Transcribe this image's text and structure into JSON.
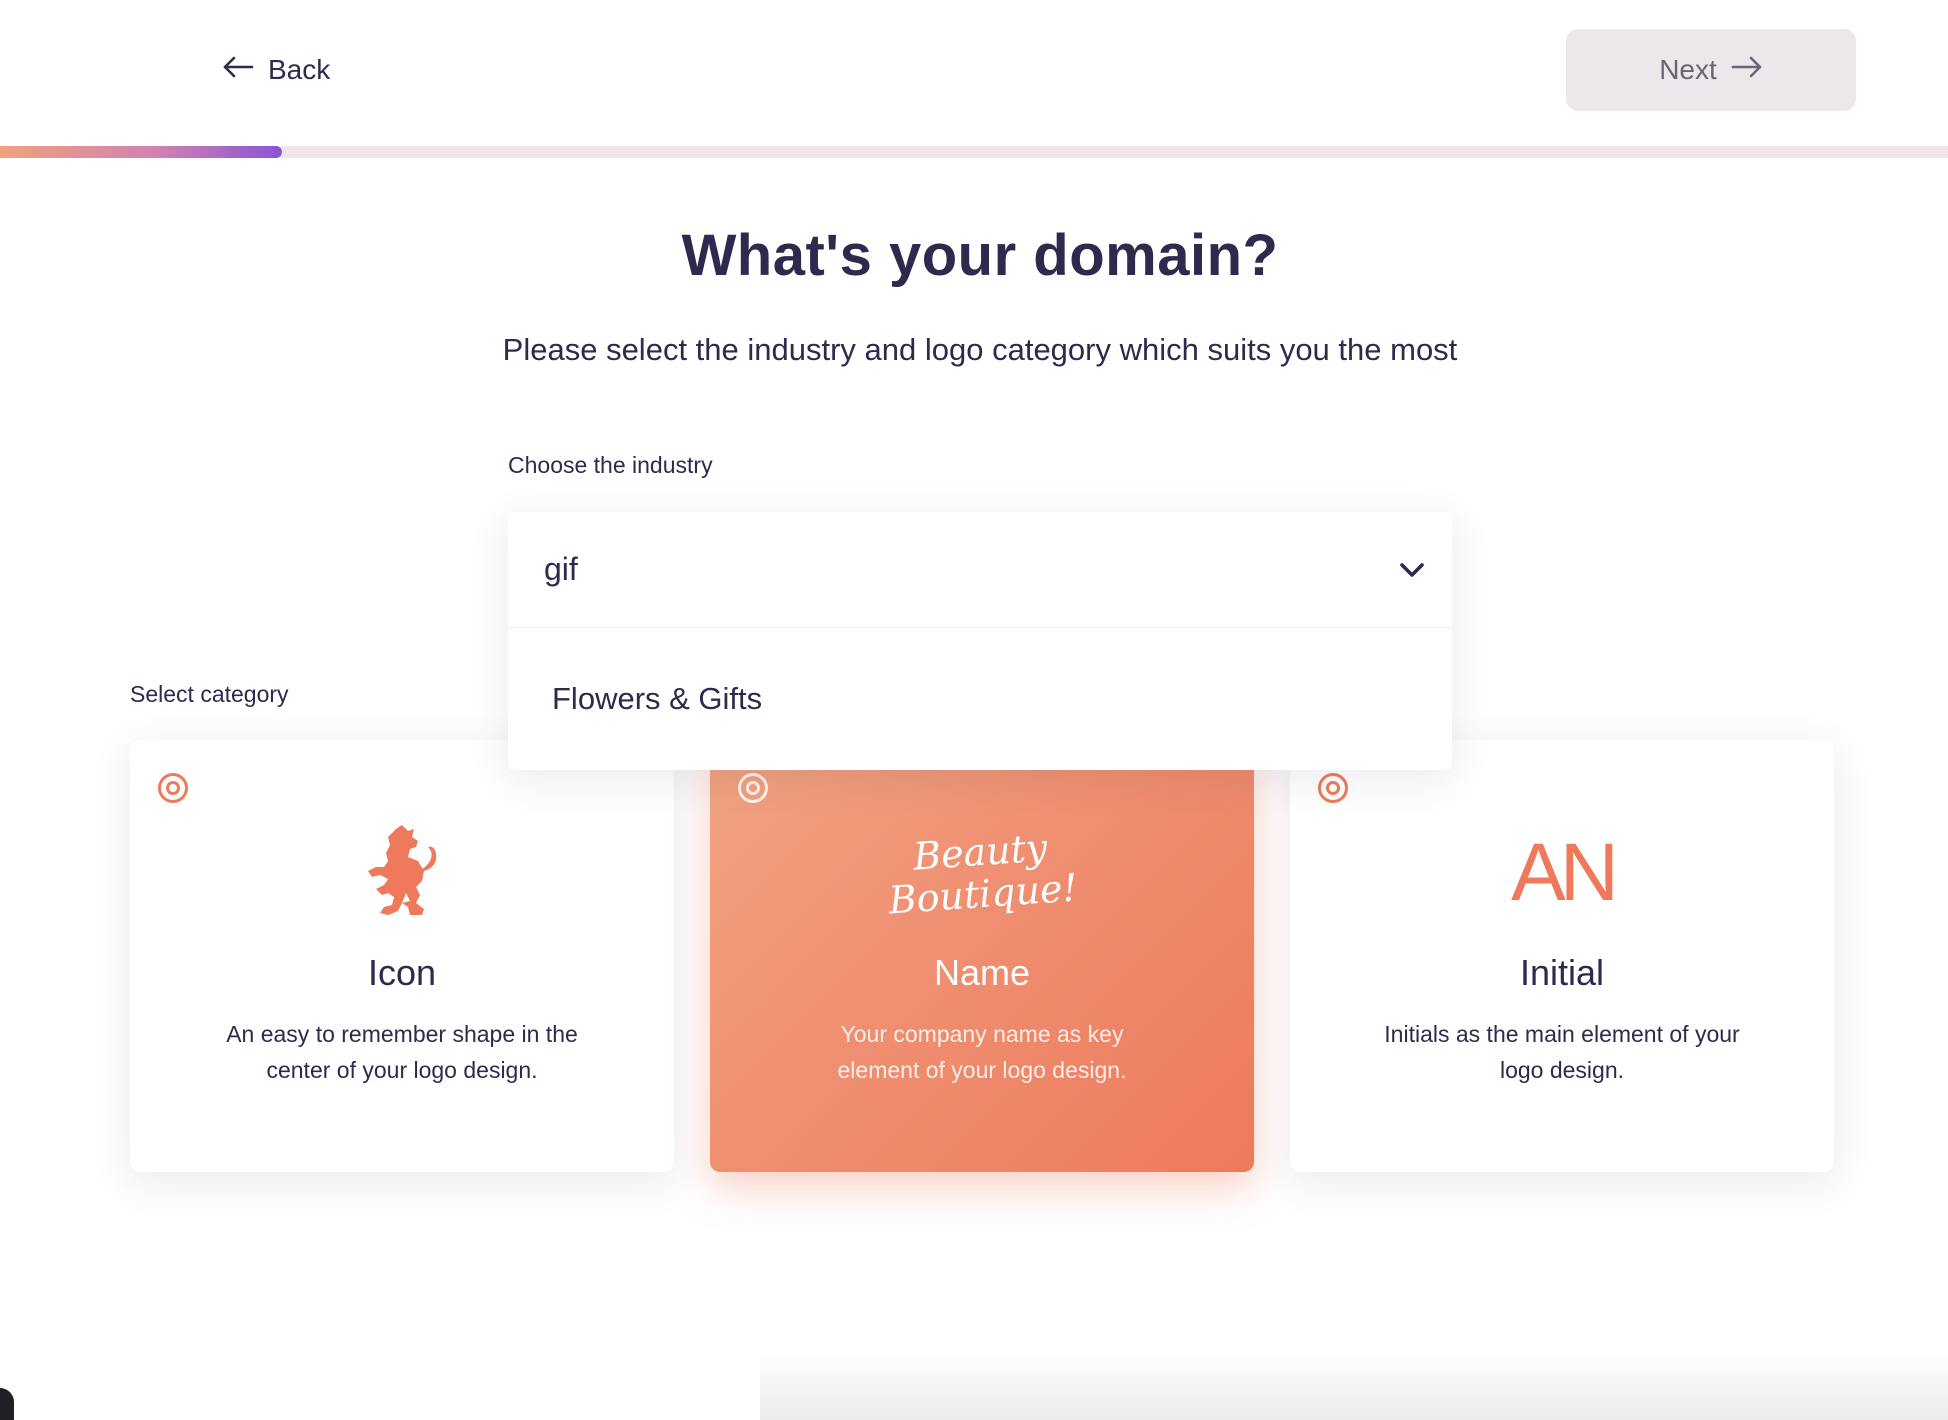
{
  "header": {
    "back_label": "Back",
    "next_label": "Next"
  },
  "progress": {
    "fraction": 0.145,
    "colors": [
      "#f0a27c",
      "#d381b0",
      "#8a55d4"
    ]
  },
  "page": {
    "title": "What's your domain?",
    "subtitle": "Please select the industry and logo category which suits you the most"
  },
  "industry": {
    "label": "Choose the industry",
    "value": "gif",
    "options": [
      "Flowers & Gifts"
    ]
  },
  "category": {
    "label": "Select category",
    "cards": [
      {
        "title": "Icon",
        "description": "An easy to remember shape in the center of your logo design.",
        "selected": false,
        "art": "lion-icon"
      },
      {
        "title": "Name",
        "description": "Your company name as key element of your logo design.",
        "selected": true,
        "art": "script-wordmark",
        "art_line1": "Beauty",
        "art_line2": "Boutique!"
      },
      {
        "title": "Initial",
        "description": "Initials as the main element of your logo design.",
        "selected": false,
        "art": "initials",
        "art_text": "AN"
      }
    ]
  },
  "colors": {
    "accent": "#ee7a5b",
    "text": "#2f2a4d",
    "button_bg": "#ece7ea"
  }
}
